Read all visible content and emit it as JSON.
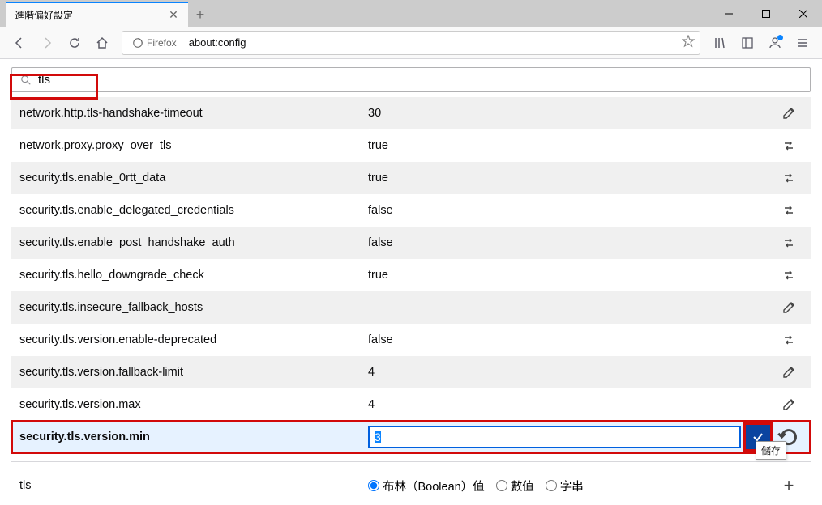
{
  "window": {
    "tab_title": "進階偏好設定"
  },
  "urlbar": {
    "identity_label": "Firefox",
    "url": "about:config"
  },
  "search": {
    "value": "tls"
  },
  "prefs": [
    {
      "name": "network.http.tls-handshake-timeout",
      "value": "30",
      "action": "edit"
    },
    {
      "name": "network.proxy.proxy_over_tls",
      "value": "true",
      "action": "toggle"
    },
    {
      "name": "security.tls.enable_0rtt_data",
      "value": "true",
      "action": "toggle"
    },
    {
      "name": "security.tls.enable_delegated_credentials",
      "value": "false",
      "action": "toggle"
    },
    {
      "name": "security.tls.enable_post_handshake_auth",
      "value": "false",
      "action": "toggle"
    },
    {
      "name": "security.tls.hello_downgrade_check",
      "value": "true",
      "action": "toggle"
    },
    {
      "name": "security.tls.insecure_fallback_hosts",
      "value": "",
      "action": "edit"
    },
    {
      "name": "security.tls.version.enable-deprecated",
      "value": "false",
      "action": "toggle"
    },
    {
      "name": "security.tls.version.fallback-limit",
      "value": "4",
      "action": "edit"
    },
    {
      "name": "security.tls.version.max",
      "value": "4",
      "action": "edit"
    }
  ],
  "editing": {
    "name": "security.tls.version.min",
    "value": "3",
    "tooltip": "儲存"
  },
  "add": {
    "name": "tls",
    "options": [
      {
        "label": "布林（Boolean）值",
        "checked": true
      },
      {
        "label": "數值",
        "checked": false
      },
      {
        "label": "字串",
        "checked": false
      }
    ]
  }
}
